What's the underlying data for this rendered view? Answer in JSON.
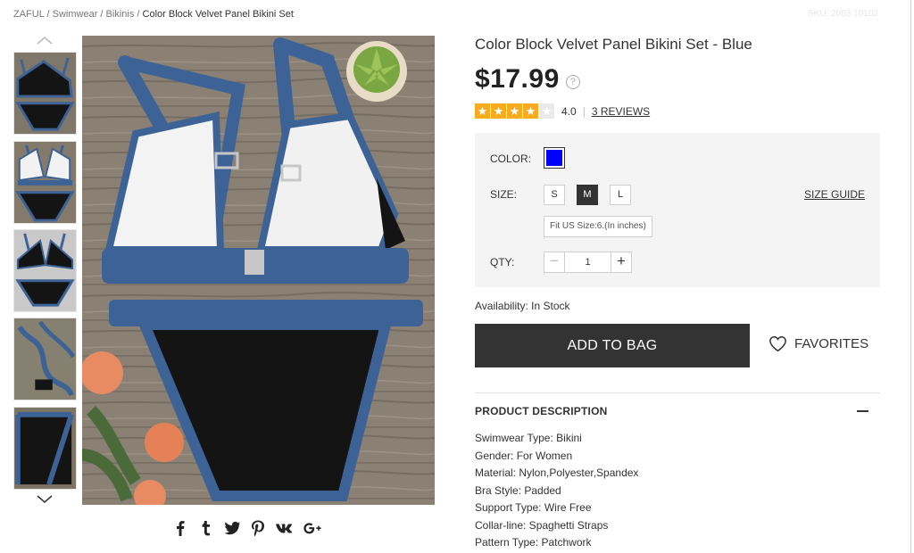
{
  "breadcrumb": {
    "items": [
      "ZAFUL",
      "Swimwear",
      "Bikinis"
    ],
    "current": "Color Block Velvet Panel Bikini Set",
    "separator": "/"
  },
  "sku": "SKU: 2003 10102",
  "gallery": {
    "up_icon": "chevron-up-icon",
    "down_icon": "chevron-down-icon",
    "thumbnails": [
      "thumbnail-1",
      "thumbnail-2",
      "thumbnail-3",
      "thumbnail-4",
      "thumbnail-5"
    ]
  },
  "share": {
    "icons": [
      "facebook-icon",
      "tumblr-icon",
      "twitter-icon",
      "pinterest-icon",
      "vk-icon",
      "google-plus-icon"
    ]
  },
  "product": {
    "title": "Color Block Velvet Panel Bikini Set - Blue",
    "price": "$17.99",
    "help_icon": "?",
    "rating": {
      "stars": 4,
      "max": 5,
      "value": "4.0",
      "separator": "|",
      "reviews": "3 REVIEWS"
    }
  },
  "options": {
    "color_label": "COLOR:",
    "color_value": "#0000ff",
    "size_label": "SIZE:",
    "sizes": [
      "S",
      "M",
      "L"
    ],
    "selected_size": "M",
    "size_guide": "SIZE GUIDE",
    "fit_note": "Fit US Size:6.(In inches)",
    "qty_label": "QTY:",
    "qty_minus": "−",
    "qty_value": "1",
    "qty_plus": "+"
  },
  "availability": "Availability: In Stock",
  "add_to_bag": "ADD TO BAG",
  "favorites": "FAVORITES",
  "description": {
    "header": "PRODUCT DESCRIPTION",
    "items": [
      "Swimwear Type: Bikini",
      "Gender: For Women",
      "Material: Nylon,Polyester,Spandex",
      "Bra Style: Padded",
      "Support Type: Wire Free",
      "Collar-line: Spaghetti Straps",
      "Pattern Type: Patchwork"
    ]
  },
  "colors": {
    "brand_dark": "#333333",
    "star": "#f7ab1d",
    "panel": "#f4f4f4",
    "swimsuit_trim": "#3d6296",
    "swimsuit_body": "#141414"
  }
}
